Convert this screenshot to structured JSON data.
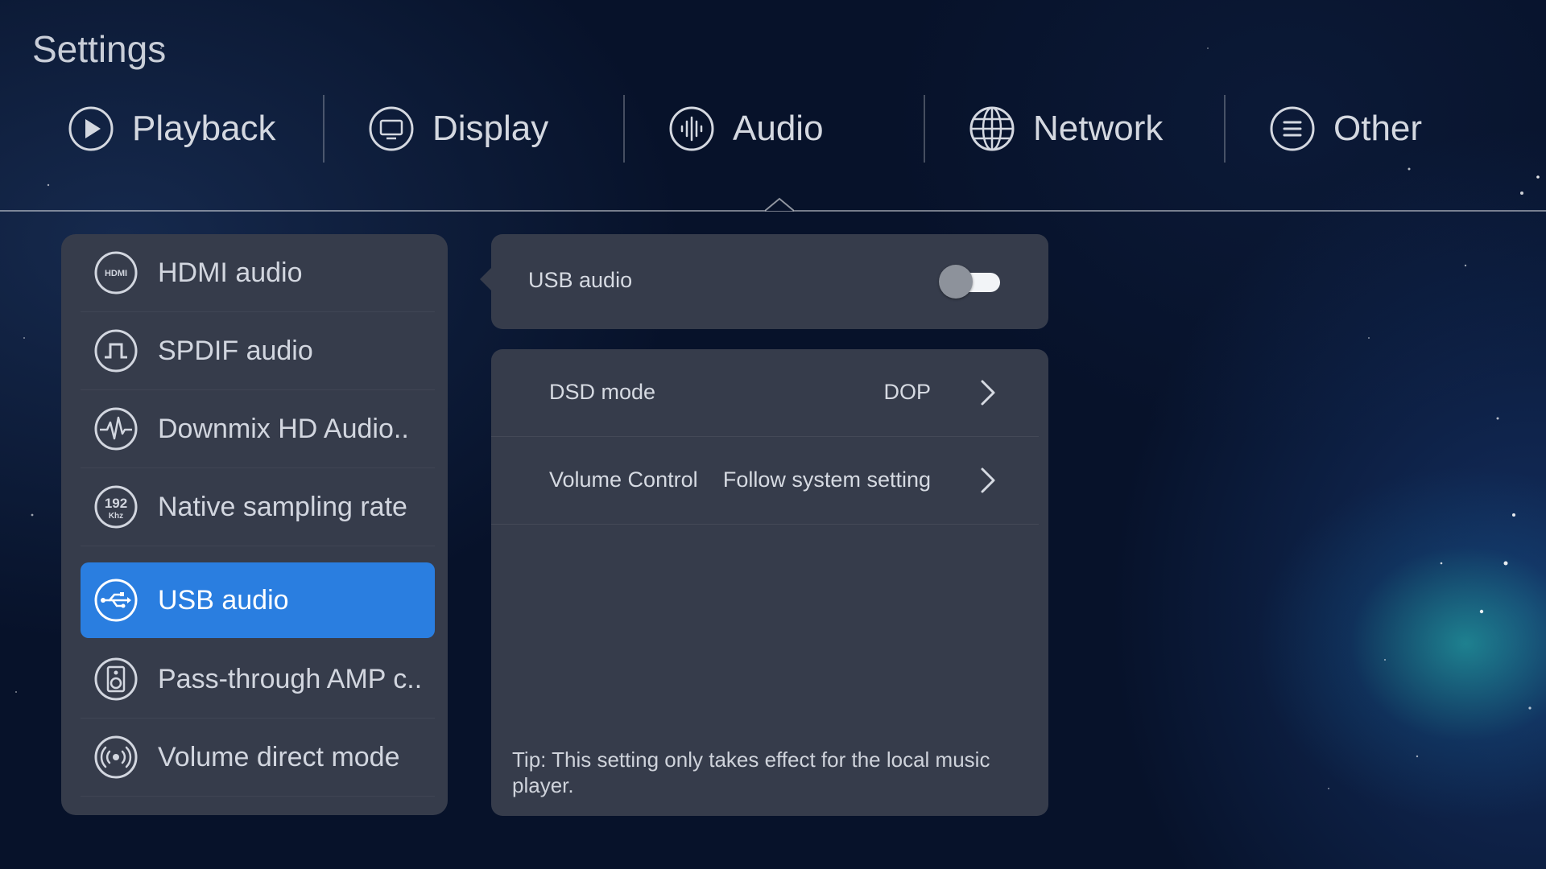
{
  "header": {
    "title": "Settings"
  },
  "tabs": [
    {
      "label": "Playback",
      "icon": "play-icon"
    },
    {
      "label": "Display",
      "icon": "monitor-icon"
    },
    {
      "label": "Audio",
      "icon": "audio-wave-icon",
      "active": true
    },
    {
      "label": "Network",
      "icon": "globe-icon"
    },
    {
      "label": "Other",
      "icon": "menu-icon"
    }
  ],
  "sidebar": {
    "items": [
      {
        "label": "HDMI audio",
        "icon": "hdmi-icon"
      },
      {
        "label": "SPDIF audio",
        "icon": "spdif-icon"
      },
      {
        "label": "Downmix HD Audio..",
        "icon": "waveform-icon"
      },
      {
        "label": "Native sampling rate",
        "icon": "192khz-icon",
        "icon_text_top": "192",
        "icon_text_bottom": "Khz"
      },
      {
        "label": "USB audio",
        "icon": "usb-icon",
        "selected": true
      },
      {
        "label": "Pass-through AMP c..",
        "icon": "speaker-icon"
      },
      {
        "label": "Volume direct mode",
        "icon": "broadcast-icon"
      }
    ]
  },
  "usb_audio": {
    "label": "USB audio",
    "toggle_on": false
  },
  "options": [
    {
      "label": "DSD mode",
      "value": "DOP"
    },
    {
      "label": "Volume Control",
      "value": "Follow system setting"
    }
  ],
  "tip": "Tip: This setting only takes effect for the local music player.",
  "colors": {
    "accent": "#2a7ee0",
    "panel": "#363c4b",
    "background": "#07122a"
  }
}
